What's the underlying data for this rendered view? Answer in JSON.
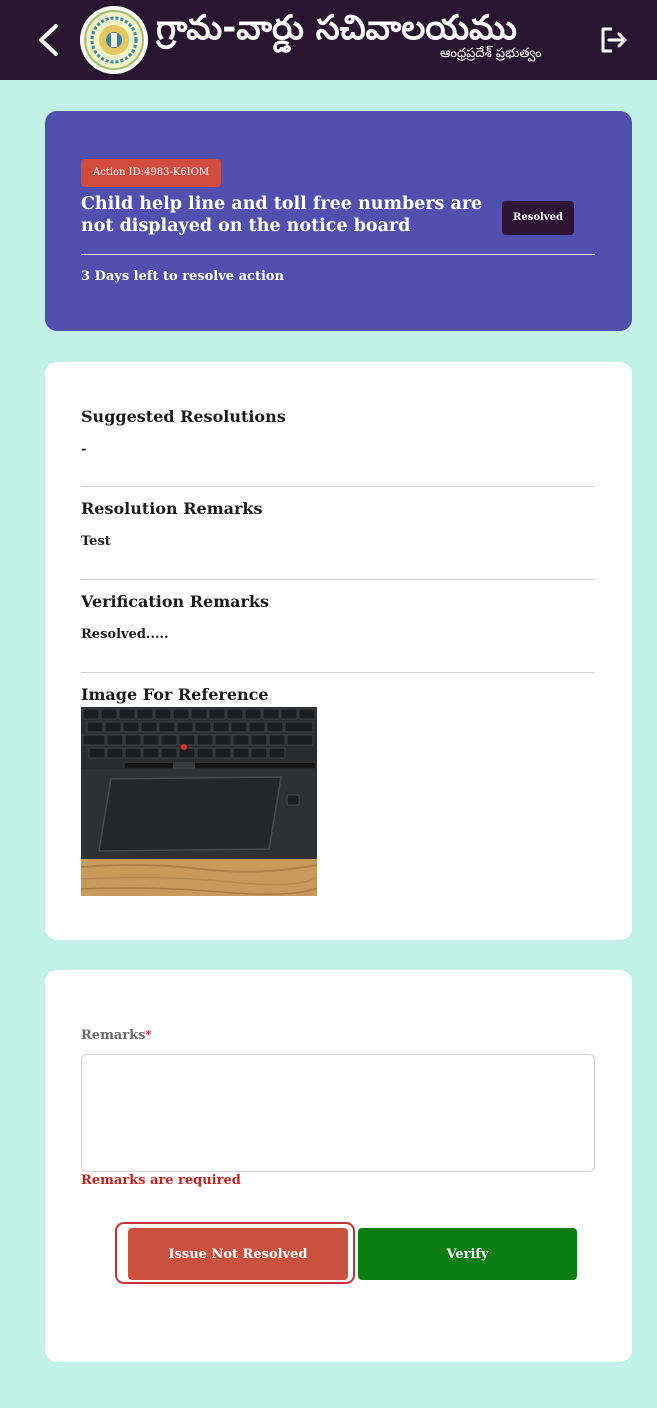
{
  "header": {
    "title": "గ్రామ-వార్డు సచివాలయము",
    "subtitle": "ఆంధ్రప్రదేశ్ ప్రభుత్వం",
    "back_icon": "chevron-left-icon",
    "logo_icon": "ap-government-emblem",
    "logout_icon": "logout-icon"
  },
  "action": {
    "id_label": "Action ID:4983-K6IOM",
    "title": "Child help line and toll free numbers are not displayed on the notice board",
    "status": "Resolved",
    "days_left": "3 Days left to resolve action"
  },
  "details": {
    "suggested_heading": "Suggested Resolutions",
    "suggested_value": "-",
    "resolution_heading": "Resolution Remarks",
    "resolution_value": "Test",
    "verification_heading": "Verification Remarks",
    "verification_value": "Resolved.....",
    "image_heading": "Image For Reference"
  },
  "form": {
    "remarks_label": "Remarks",
    "required_mark": "*",
    "remarks_value": "",
    "remarks_error": "Remarks are required",
    "not_resolved_label": "Issue Not Resolved",
    "verify_label": "Verify"
  },
  "colors": {
    "header_bg": "#2a1530",
    "page_bg": "#c2f1ea",
    "action_card_bg": "#5150ae",
    "action_id_bg": "#d14c3e",
    "status_badge_bg": "#2d1435",
    "not_resolved_bg": "#c9513d",
    "verify_bg": "#0c7d12",
    "error_text": "#c81f1f"
  }
}
